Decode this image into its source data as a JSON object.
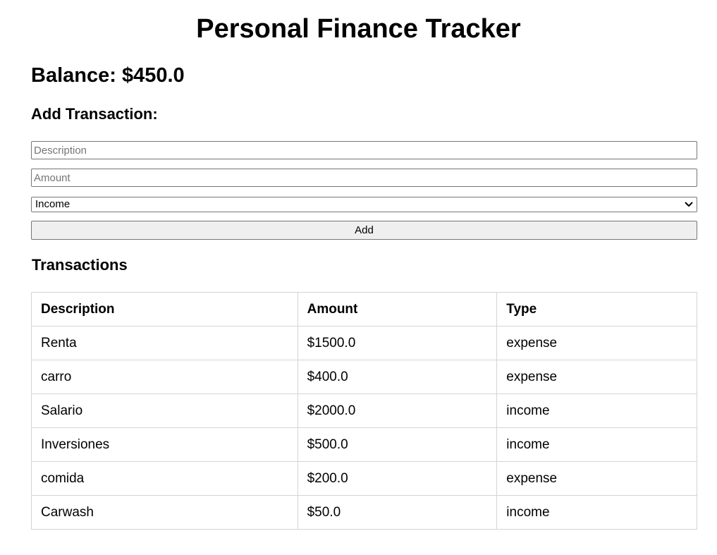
{
  "header": {
    "title": "Personal Finance Tracker",
    "balance": "Balance: $450.0"
  },
  "form": {
    "heading": "Add Transaction:",
    "description_placeholder": "Description",
    "description_value": "",
    "amount_placeholder": "Amount",
    "amount_value": "",
    "type_selected": "Income",
    "add_label": "Add"
  },
  "transactions": {
    "title": "Transactions",
    "columns": [
      "Description",
      "Amount",
      "Type"
    ],
    "rows": [
      [
        "Renta",
        "$1500.0",
        "expense"
      ],
      [
        "carro",
        "$400.0",
        "expense"
      ],
      [
        "Salario",
        "$2000.0",
        "income"
      ],
      [
        "Inversiones",
        "$500.0",
        "income"
      ],
      [
        "comida",
        "$200.0",
        "expense"
      ],
      [
        "Carwash",
        "$50.0",
        "income"
      ]
    ]
  },
  "icons": {
    "select_arrow": "chevron-down-icon"
  }
}
